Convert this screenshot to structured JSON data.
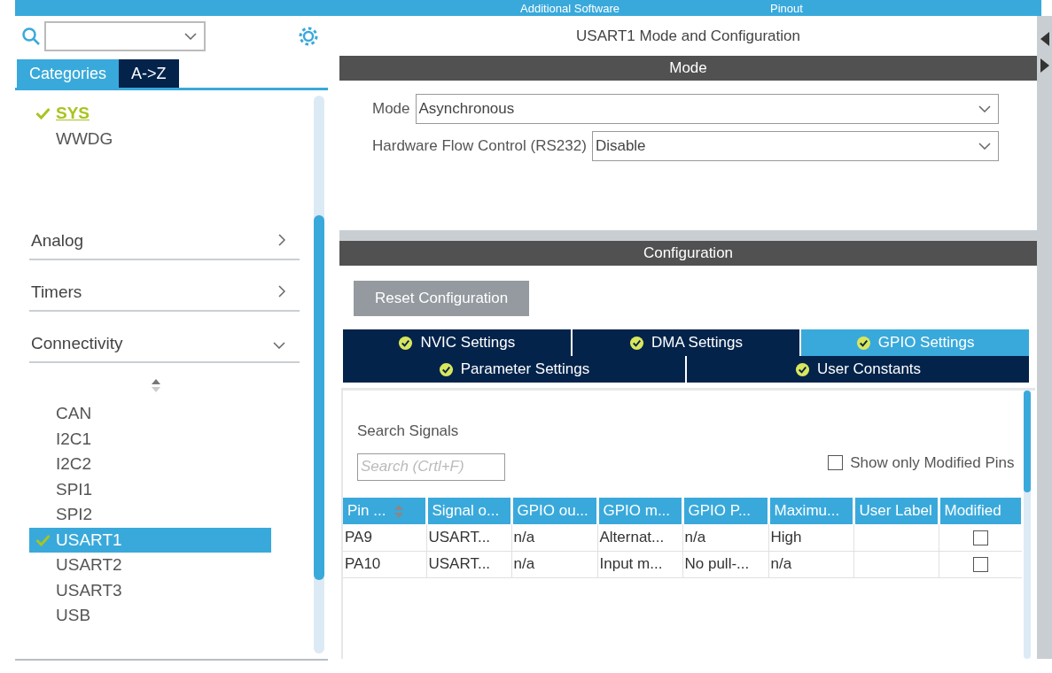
{
  "top_bar": {
    "items": [
      "Additional Software",
      "Pinout"
    ]
  },
  "sidebar": {
    "tabs": [
      {
        "label": "Categories",
        "selected": true
      },
      {
        "label": "A->Z",
        "selected": false
      }
    ],
    "items": [
      {
        "label": "SYS",
        "checked": true,
        "selected": false
      },
      {
        "label": "WWDG",
        "checked": false,
        "selected": false
      }
    ],
    "categories": [
      {
        "label": "Analog",
        "expanded": false
      },
      {
        "label": "Timers",
        "expanded": false
      },
      {
        "label": "Connectivity",
        "expanded": true,
        "children": [
          {
            "label": "CAN",
            "checked": false,
            "selected": false
          },
          {
            "label": "I2C1",
            "checked": false,
            "selected": false
          },
          {
            "label": "I2C2",
            "checked": false,
            "selected": false
          },
          {
            "label": "SPI1",
            "checked": false,
            "selected": false
          },
          {
            "label": "SPI2",
            "checked": false,
            "selected": false
          },
          {
            "label": "USART1",
            "checked": true,
            "selected": true
          },
          {
            "label": "USART2",
            "checked": false,
            "selected": false
          },
          {
            "label": "USART3",
            "checked": false,
            "selected": false
          },
          {
            "label": "USB",
            "checked": false,
            "selected": false
          }
        ]
      }
    ]
  },
  "panel_title": "USART1 Mode and Configuration",
  "mode": {
    "header": "Mode",
    "fields": [
      {
        "label": "Mode",
        "value": "Asynchronous"
      },
      {
        "label": "Hardware Flow Control (RS232)",
        "value": "Disable"
      }
    ]
  },
  "configuration": {
    "header": "Configuration",
    "reset_button": "Reset Configuration",
    "tab_rows": [
      [
        {
          "label": "NVIC Settings",
          "selected": false
        },
        {
          "label": "DMA Settings",
          "selected": false
        },
        {
          "label": "GPIO Settings",
          "selected": true
        }
      ],
      [
        {
          "label": "Parameter Settings",
          "selected": false
        },
        {
          "label": "User Constants",
          "selected": false
        }
      ]
    ],
    "search_label": "Search Signals",
    "search": {
      "placeholder": "Search (Crtl+F)"
    },
    "show_modified": {
      "label": "Show only Modified Pins",
      "checked": false
    },
    "table": {
      "columns": [
        "Pin ...",
        "Signal o...",
        "GPIO ou...",
        "GPIO m...",
        "GPIO P...",
        "Maximu...",
        "User Label",
        "Modified"
      ],
      "rows": [
        {
          "cells": [
            "PA9",
            "USART...",
            "n/a",
            "Alternat...",
            "n/a",
            "High",
            ""
          ],
          "modified": false
        },
        {
          "cells": [
            "PA10",
            "USART...",
            "n/a",
            "Input m...",
            "No pull-...",
            "n/a",
            ""
          ],
          "modified": false
        }
      ]
    }
  }
}
